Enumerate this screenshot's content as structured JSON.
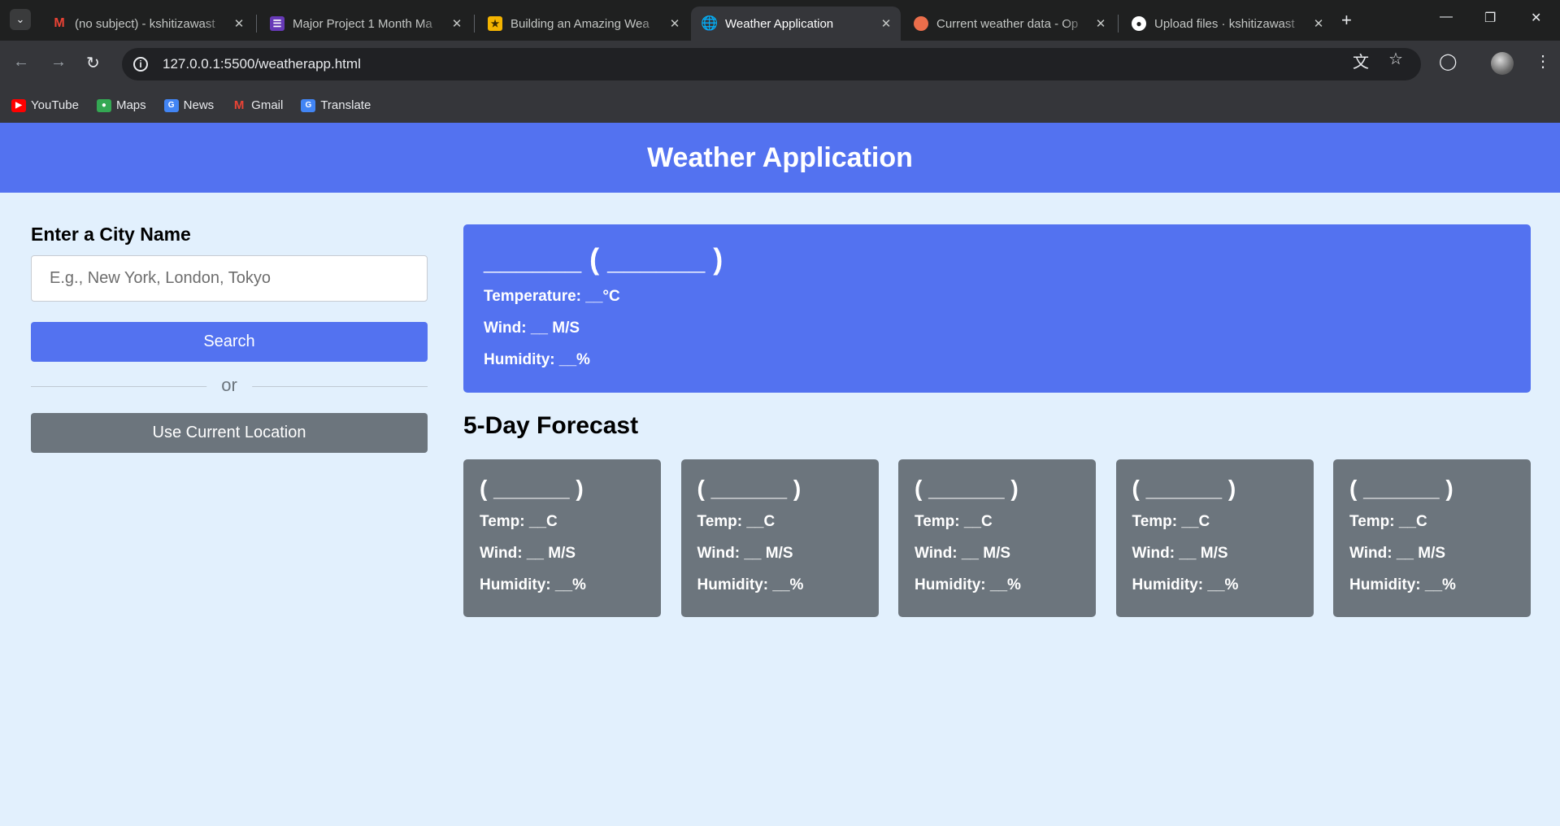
{
  "browser": {
    "tabs": [
      {
        "title": "(no subject) - kshitizawast",
        "icon": "gmail-icon",
        "icon_color": "#ea4335",
        "active": false
      },
      {
        "title": "Major Project 1 Month Ma",
        "icon": "forms-icon",
        "icon_color": "#673ab7",
        "active": false
      },
      {
        "title": "Building an Amazing Wea",
        "icon": "article-icon",
        "icon_color": "#f4b400",
        "active": false
      },
      {
        "title": "Weather Application",
        "icon": "globe-icon",
        "icon_color": "#9aa0a6",
        "active": true
      },
      {
        "title": "Current weather data - Op",
        "icon": "openweather-icon",
        "icon_color": "#eb6e4b",
        "active": false
      },
      {
        "title": "Upload files · kshitizawast",
        "icon": "github-icon",
        "icon_color": "#ffffff",
        "active": false
      }
    ],
    "url": "127.0.0.1:5500/weatherapp.html",
    "bookmarks": [
      {
        "label": "YouTube",
        "icon": "youtube-icon",
        "icon_color": "#ff0000"
      },
      {
        "label": "Maps",
        "icon": "maps-icon",
        "icon_color": "#34a853"
      },
      {
        "label": "News",
        "icon": "news-icon",
        "icon_color": "#4285f4"
      },
      {
        "label": "Gmail",
        "icon": "gmail-icon",
        "icon_color": "#ea4335"
      },
      {
        "label": "Translate",
        "icon": "translate-icon",
        "icon_color": "#4285f4"
      }
    ]
  },
  "app": {
    "title": "Weather Application",
    "colors": {
      "primary": "#5372f0",
      "secondary": "#6c757d",
      "background": "#e2f0fd"
    },
    "input_panel": {
      "label": "Enter a City Name",
      "placeholder": "E.g., New York, London, Tokyo",
      "value": "",
      "search_label": "Search",
      "separator_text": "or",
      "location_label": "Use Current Location"
    },
    "current": {
      "title": "______ ( ______ )",
      "temperature": "Temperature: __°C",
      "wind": "Wind: __ M/S",
      "humidity": "Humidity: __%"
    },
    "forecast_heading": "5-Day Forecast",
    "forecast": [
      {
        "title": "( ______ )",
        "temp": "Temp: __C",
        "wind": "Wind: __ M/S",
        "humidity": "Humidity: __%"
      },
      {
        "title": "( ______ )",
        "temp": "Temp: __C",
        "wind": "Wind: __ M/S",
        "humidity": "Humidity: __%"
      },
      {
        "title": "( ______ )",
        "temp": "Temp: __C",
        "wind": "Wind: __ M/S",
        "humidity": "Humidity: __%"
      },
      {
        "title": "( ______ )",
        "temp": "Temp: __C",
        "wind": "Wind: __ M/S",
        "humidity": "Humidity: __%"
      },
      {
        "title": "( ______ )",
        "temp": "Temp: __C",
        "wind": "Wind: __ M/S",
        "humidity": "Humidity: __%"
      }
    ]
  }
}
